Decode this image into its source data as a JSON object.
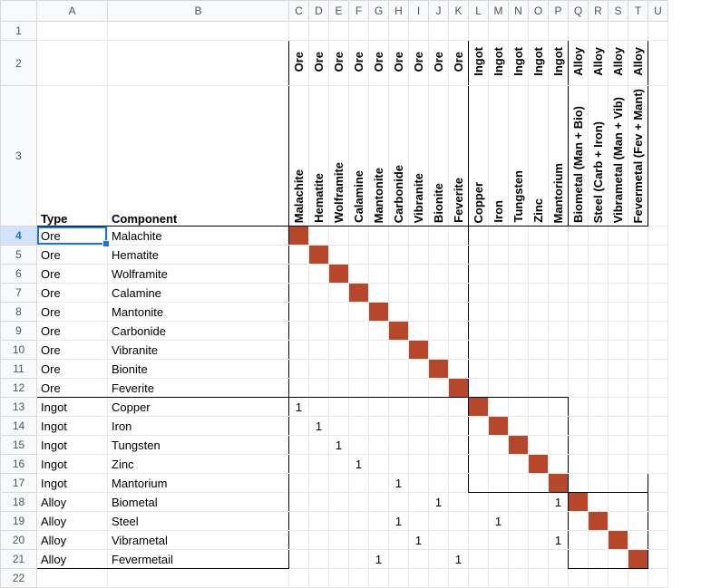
{
  "columns": [
    "",
    "A",
    "B",
    "C",
    "D",
    "E",
    "F",
    "G",
    "H",
    "I",
    "J",
    "K",
    "L",
    "M",
    "N",
    "O",
    "P",
    "Q",
    "R",
    "S",
    "T",
    "U"
  ],
  "rownums": [
    "1",
    "2",
    "3",
    "4",
    "5",
    "6",
    "7",
    "8",
    "9",
    "10",
    "11",
    "12",
    "13",
    "14",
    "15",
    "16",
    "17",
    "18",
    "19",
    "20",
    "21",
    "22"
  ],
  "hdr_row2": [
    "Ore",
    "Ore",
    "Ore",
    "Ore",
    "Ore",
    "Ore",
    "Ore",
    "Ore",
    "Ore",
    "Ingot",
    "Ingot",
    "Ingot",
    "Ingot",
    "Ingot",
    "Alloy",
    "Alloy",
    "Alloy",
    "Alloy"
  ],
  "hdr_row3": [
    "Malachite",
    "Hematite",
    "Wolframite",
    "Calamine",
    "Mantonite",
    "Carbonide",
    "Vibranite",
    "Bionite",
    "Feverite",
    "Copper",
    "Iron",
    "Tungsten",
    "Zinc",
    "Mantorium",
    "Biometal (Man + Bio)",
    "Steel (Carb + Iron)",
    "Vibrametal (Man + Vib)",
    "Fevermetal (Fev + Mant)"
  ],
  "a3_label": "Type",
  "b3_label": "Component",
  "rows": [
    {
      "n": "4",
      "type": "Ore",
      "comp": "Malachite"
    },
    {
      "n": "5",
      "type": "Ore",
      "comp": "Hematite"
    },
    {
      "n": "6",
      "type": "Ore",
      "comp": "Wolframite"
    },
    {
      "n": "7",
      "type": "Ore",
      "comp": "Calamine"
    },
    {
      "n": "8",
      "type": "Ore",
      "comp": "Mantonite"
    },
    {
      "n": "9",
      "type": "Ore",
      "comp": "Carbonide"
    },
    {
      "n": "10",
      "type": "Ore",
      "comp": "Vibranite"
    },
    {
      "n": "11",
      "type": "Ore",
      "comp": "Bionite"
    },
    {
      "n": "12",
      "type": "Ore",
      "comp": "Feverite"
    },
    {
      "n": "13",
      "type": "Ingot",
      "comp": "Copper"
    },
    {
      "n": "14",
      "type": "Ingot",
      "comp": "Iron"
    },
    {
      "n": "15",
      "type": "Ingot",
      "comp": "Tungsten"
    },
    {
      "n": "16",
      "type": "Ingot",
      "comp": "Zinc"
    },
    {
      "n": "17",
      "type": "Ingot",
      "comp": "Mantorium"
    },
    {
      "n": "18",
      "type": "Alloy",
      "comp": "Biometal"
    },
    {
      "n": "19",
      "type": "Alloy",
      "comp": "Steel"
    },
    {
      "n": "20",
      "type": "Alloy",
      "comp": "Vibrametal"
    },
    {
      "n": "21",
      "type": "Alloy",
      "comp": "Fevermetail"
    }
  ],
  "chart_data": {
    "type": "heatmap",
    "title": "",
    "row_labels": [
      "Malachite",
      "Hematite",
      "Wolframite",
      "Calamine",
      "Mantonite",
      "Carbonide",
      "Vibranite",
      "Bionite",
      "Feverite",
      "Copper",
      "Iron",
      "Tungsten",
      "Zinc",
      "Mantorium",
      "Biometal",
      "Steel",
      "Vibrametal",
      "Fevermetail"
    ],
    "col_labels": [
      "Malachite",
      "Hematite",
      "Wolframite",
      "Calamine",
      "Mantonite",
      "Carbonide",
      "Vibranite",
      "Bionite",
      "Feverite",
      "Copper",
      "Iron",
      "Tungsten",
      "Zinc",
      "Mantorium",
      "Biometal (Man + Bio)",
      "Steel (Carb + Iron)",
      "Vibrametal (Man + Vib)",
      "Fevermetal (Fev + Mant)"
    ],
    "cells": {
      "Malachite": {
        "Malachite": "sq"
      },
      "Hematite": {
        "Hematite": "sq"
      },
      "Wolframite": {
        "Wolframite": "sq"
      },
      "Calamine": {
        "Calamine": "sq"
      },
      "Mantonite": {
        "Mantonite": "sq"
      },
      "Carbonide": {
        "Carbonide": "sq"
      },
      "Vibranite": {
        "Vibranite": "sq"
      },
      "Bionite": {
        "Bionite": "sq"
      },
      "Feverite": {
        "Feverite": "sq"
      },
      "Copper": {
        "Malachite": 1,
        "Copper": "sq"
      },
      "Iron": {
        "Hematite": 1,
        "Iron": "sq"
      },
      "Tungsten": {
        "Wolframite": 1,
        "Tungsten": "sq"
      },
      "Zinc": {
        "Calamine": 1,
        "Zinc": "sq"
      },
      "Mantorium": {
        "Carbonide": 1,
        "Mantorium": "sq"
      },
      "Biometal": {
        "Bionite": 1,
        "Mantorium": 1,
        "Biometal (Man + Bio)": "sq"
      },
      "Steel": {
        "Carbonide": 1,
        "Iron": 1,
        "Steel (Carb + Iron)": "sq"
      },
      "Vibrametal": {
        "Vibranite": 1,
        "Mantorium": 1,
        "Vibrametal (Man + Vib)": "sq"
      },
      "Fevermetail": {
        "Mantonite": 1,
        "Feverite": 1,
        "Fevermetal (Fev + Mant)": "sq"
      }
    }
  },
  "one": "1"
}
